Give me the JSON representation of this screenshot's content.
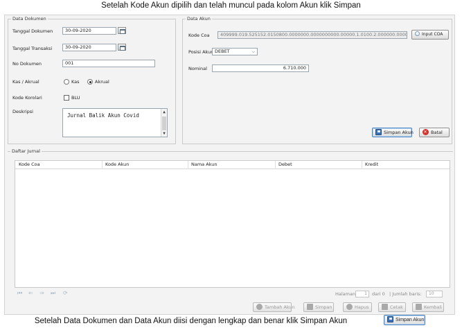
{
  "captions": {
    "top": "Setelah Kode Akun dipilih dan telah muncul pada kolom Akun klik Simpan",
    "bottom": "Setelah Data Dokumen dan Data Akun diisi dengan lengkap dan benar klik Simpan Akun",
    "bottom_button": "Simpan Akun"
  },
  "data_dokumen": {
    "legend": "Data Dokumen",
    "tanggal_dokumen_label": "Tanggal Dokumen",
    "tanggal_dokumen_value": "30-09-2020",
    "tanggal_transaksi_label": "Tanggal Transaksi",
    "tanggal_transaksi_value": "30-09-2020",
    "no_dokumen_label": "No Dokumen",
    "no_dokumen_value": "001",
    "kas_akrual_label": "Kas / Akrual",
    "kas_option": "Kas",
    "akrual_option": "Akrual",
    "selected_option": "Akrual",
    "kode_korolari_label": "Kode Korolari",
    "blu_label": "BLU",
    "blu_checked": false,
    "deskripsi_label": "Deskripsi",
    "deskripsi_value": "Jurnal Balik Akun Covid"
  },
  "data_akun": {
    "legend": "Data Akun",
    "kode_coa_label": "Kode Coa",
    "kode_coa_value": "409999.019.525152.0150800.0000000.0000000000.00000.1.0100.2.000000.000000",
    "input_coa_button": "Input COA",
    "posisi_akun_label": "Posisi Akun",
    "posisi_akun_value": "DEBET",
    "nominal_label": "Nominal",
    "nominal_value": "6.710.000",
    "simpan_akun_button": "Simpan Akun",
    "batal_button": "Batal"
  },
  "daftar_jurnal": {
    "legend": "Daftar Jurnal",
    "columns": [
      "Kode Coa",
      "Kode Akun",
      "Nama Akun",
      "Debet",
      "Kredit"
    ],
    "rows": []
  },
  "pager": {
    "halaman_label": "Halaman",
    "halaman_value": "1",
    "dari_text": "dari 0",
    "jumlah_baris_label": "| Jumlah baris:",
    "jumlah_baris_value": "10"
  },
  "footer_buttons": {
    "tambah_akun": "Tambah Akun",
    "simpan": "Simpan",
    "hapus": "Hapus",
    "cetak": "Cetak",
    "kembali": "Kembali"
  },
  "icons": {
    "calendar": "calendar-icon",
    "save": "floppy-icon",
    "cancel": "cancel-icon",
    "search": "search-icon"
  },
  "colors": {
    "accent": "#3a73b8",
    "cancel": "#d0342c"
  }
}
